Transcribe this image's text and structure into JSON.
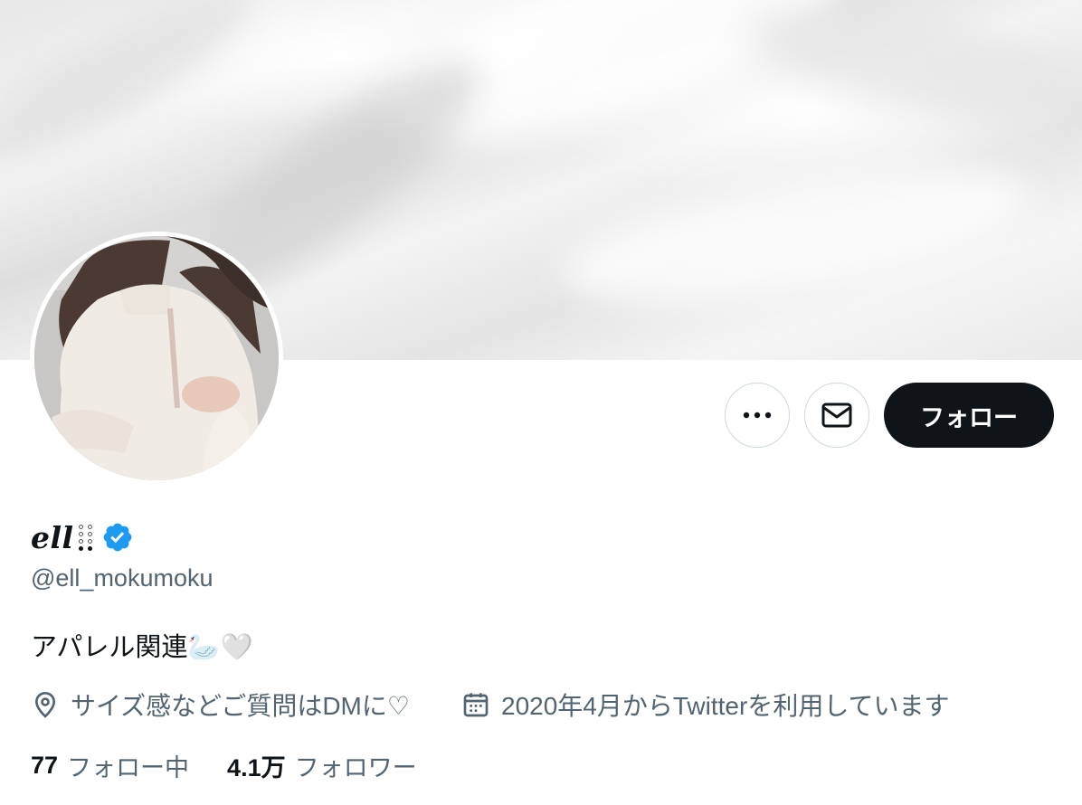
{
  "banner": {
    "icon": "fabric-photo"
  },
  "avatar": {
    "icon": "profile-photo"
  },
  "actions": {
    "more_icon": "ellipsis-icon",
    "message_icon": "envelope-icon",
    "follow_label": "フォロー"
  },
  "profile": {
    "display_name": "ell",
    "display_name_suffix": "⠿⠿",
    "verified_icon": "verified-badge-icon",
    "handle": "@ell_mokumoku",
    "bio": "アパレル関連🦢🤍",
    "location_icon": "location-pin-icon",
    "location": "サイズ感などご質問はDMに♡",
    "joined_icon": "calendar-icon",
    "joined": "2020年4月からTwitterを利用しています"
  },
  "stats": {
    "following_count": "77",
    "following_label": "フォロー中",
    "followers_count": "4.1万",
    "followers_label": "フォロワー"
  },
  "colors": {
    "text": "#0f1419",
    "secondary": "#536471",
    "verified": "#1d9bf0",
    "border": "#cfd9de",
    "follow_bg": "#0f1419"
  }
}
